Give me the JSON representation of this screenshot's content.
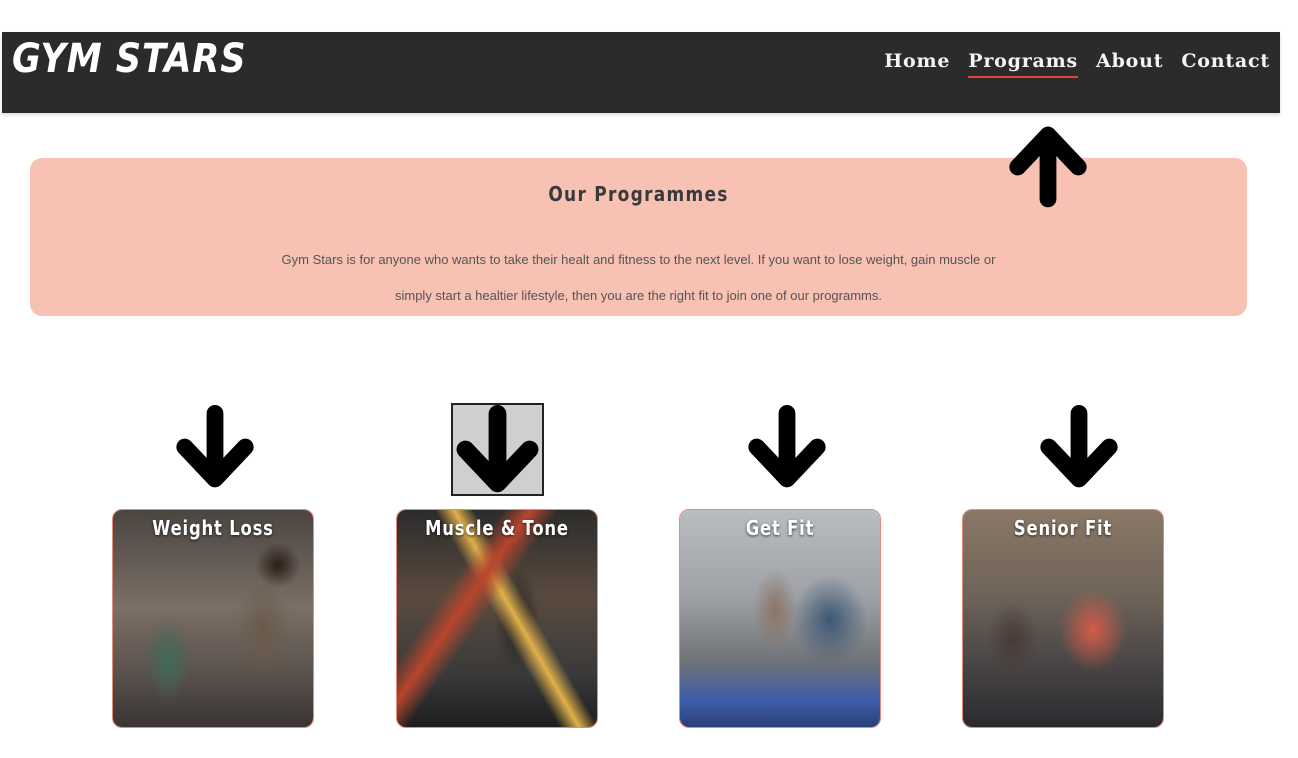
{
  "header": {
    "brand": "GYM STARS",
    "nav": [
      {
        "label": "Home",
        "active": false
      },
      {
        "label": "Programs",
        "active": true
      },
      {
        "label": "About",
        "active": false
      },
      {
        "label": "Contact",
        "active": false
      }
    ]
  },
  "intro": {
    "title": "Our Programmes",
    "text": "Gym Stars is for anyone who wants to take their healt and fitness to the next level. If you want to lose weight, gain muscle or simply start a healtier lifestyle, then you are the right fit to join one of our programms."
  },
  "programs": [
    {
      "title": "Weight Loss"
    },
    {
      "title": "Muscle & Tone"
    },
    {
      "title": "Get Fit"
    },
    {
      "title": "Senior Fit"
    }
  ],
  "colors": {
    "header_bg": "#2b2b2b",
    "intro_bg": "#f7c1b3",
    "active_underline": "#e0473a",
    "card_border": "#e88a78"
  },
  "icons": {
    "up_arrow": "arrow-up-icon",
    "down_arrow": "arrow-down-icon"
  }
}
